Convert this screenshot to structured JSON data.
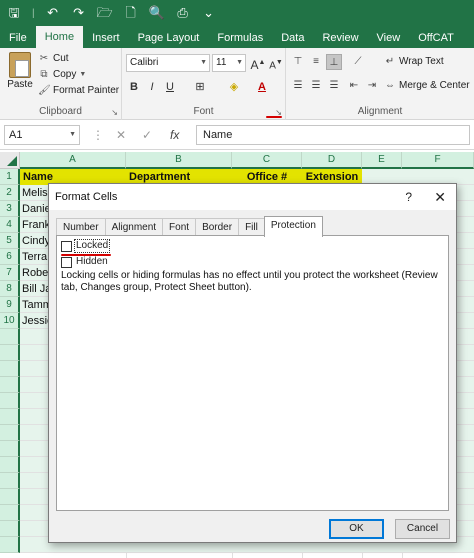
{
  "quick_access": [
    {
      "icon": "save-icon",
      "glyph": "🖫"
    },
    {
      "icon": "undo-icon",
      "glyph": "↶"
    },
    {
      "icon": "redo-icon",
      "glyph": "↷"
    },
    {
      "icon": "open-folder-icon",
      "glyph": "🗁"
    },
    {
      "icon": "new-document-icon",
      "glyph": "🗋"
    },
    {
      "icon": "print-preview-icon",
      "glyph": "🔍"
    },
    {
      "icon": "print-icon",
      "glyph": "⎙"
    },
    {
      "icon": "customize-icon",
      "glyph": "⌄"
    }
  ],
  "ribbon_tabs": [
    "File",
    "Home",
    "Insert",
    "Page Layout",
    "Formulas",
    "Data",
    "Review",
    "View",
    "OffCAT"
  ],
  "active_tab": "Home",
  "clipboard": {
    "paste_label": "Paste",
    "cut_label": "Cut",
    "copy_label": "Copy",
    "format_painter_label": "Format Painter",
    "group_label": "Clipboard"
  },
  "font": {
    "font_name": "Calibri",
    "font_size": "11",
    "group_label": "Font"
  },
  "alignment": {
    "wrap_text_label": "Wrap Text",
    "merge_center_label": "Merge & Center",
    "group_label": "Alignment"
  },
  "formula_bar": {
    "name_box": "A1",
    "cancel_glyph": "✕",
    "enter_glyph": "✓",
    "fx_glyph": "fx",
    "content": "Name"
  },
  "columns": [
    "A",
    "B",
    "C",
    "D",
    "E",
    "F"
  ],
  "rows": [
    "1",
    "2",
    "3",
    "4",
    "5",
    "6",
    "7",
    "8",
    "9",
    "10"
  ],
  "header_row": {
    "a": "Name",
    "b": "Department",
    "c": "Office #",
    "d": "Extension"
  },
  "names": [
    "Melis",
    "Danie",
    "Frank",
    "Cindy",
    "Terra",
    "Rober",
    "Bill Ja",
    "Tamm",
    "Jessic"
  ],
  "dialog": {
    "title": "Format Cells",
    "help": "?",
    "close": "✕",
    "tabs": [
      "Number",
      "Alignment",
      "Font",
      "Border",
      "Fill",
      "Protection"
    ],
    "active_tab": "Protection",
    "locked_label": "Locked",
    "locked_checked": false,
    "hidden_label": "Hidden",
    "hidden_checked": false,
    "note": "Locking cells or hiding formulas has no effect until you protect the worksheet (Review tab, Changes group, Protect Sheet button).",
    "ok_label": "OK",
    "cancel_label": "Cancel"
  },
  "colors": {
    "excel_green": "#217346",
    "header_fill": "#e3e300",
    "annotation_red": "#d40000"
  }
}
